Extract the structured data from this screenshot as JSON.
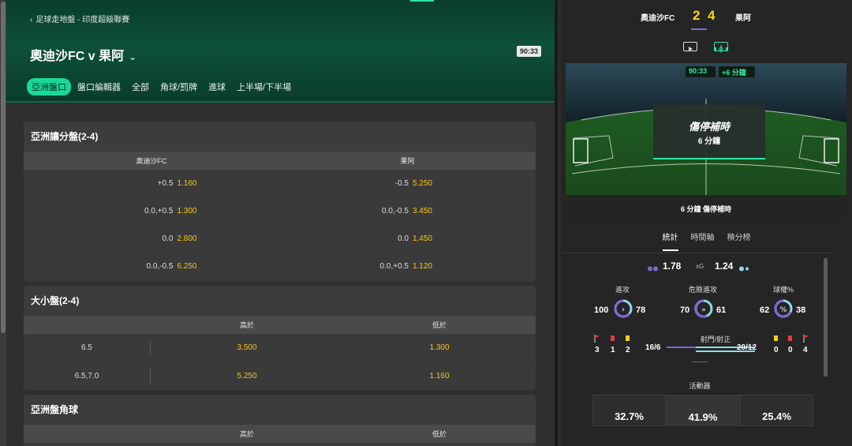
{
  "breadcrumb": "足球走地盤 - 印度超級聯賽",
  "match": {
    "title": "奧迪沙FC v 果阿",
    "clock": "90:33"
  },
  "tabs": [
    "亞洲盤口",
    "盤口編輯器",
    "全部",
    "角球/罰牌",
    "進球",
    "上半場/下半場"
  ],
  "markets": {
    "handicap": {
      "title": "亞洲讓分盤(2-4)",
      "home_header": "奧迪沙FC",
      "away_header": "果阿",
      "rows": [
        {
          "home_line": "+0.5",
          "home_odds": "1.160",
          "away_line": "-0.5",
          "away_odds": "5.250"
        },
        {
          "home_line": "0.0,+0.5",
          "home_odds": "1.300",
          "away_line": "0.0,-0.5",
          "away_odds": "3.450"
        },
        {
          "home_line": "0.0",
          "home_odds": "2.800",
          "away_line": "0.0",
          "away_odds": "1.450"
        },
        {
          "home_line": "0.0,-0.5",
          "home_odds": "6.250",
          "away_line": "0.0,+0.5",
          "away_odds": "1.120"
        }
      ]
    },
    "totals": {
      "title": "大小盤(2-4)",
      "over_header": "高於",
      "under_header": "低於",
      "rows": [
        {
          "line": "6.5",
          "over": "3.500",
          "under": "1.300"
        },
        {
          "line": "6.5,7.0",
          "over": "5.250",
          "under": "1.160"
        }
      ]
    },
    "corners": {
      "title": "亞洲盤角球",
      "over_header": "高於",
      "under_header": "低於"
    }
  },
  "scoreboard": {
    "home": "奧迪沙FC",
    "home_score": "2",
    "away_score": "4",
    "away": "果阿"
  },
  "scene": {
    "clock": "90:33",
    "added_badge": "+6 分鐘",
    "card_title": "傷停補時",
    "card_sub": "6 分鐘",
    "bottom_text": "6 分鐘  傷停補時"
  },
  "stats_tabs": [
    "統計",
    "時間軸",
    "積分榜"
  ],
  "xg": {
    "home": "1.78",
    "label": "xG",
    "away": "1.24"
  },
  "attacks": {
    "label": "進攻",
    "home": "100",
    "away": "78"
  },
  "danger": {
    "label": "危險進攻",
    "home": "70",
    "away": "61"
  },
  "possession": {
    "label": "球權%",
    "home": "62",
    "away": "38"
  },
  "cards": {
    "home_corners": "3",
    "home_red": "1",
    "home_yellow": "2",
    "away_yellow": "0",
    "away_red": "0",
    "away_corners": "4"
  },
  "shots": {
    "label": "射門/射正",
    "home": "16/6",
    "away": "20/12"
  },
  "activity": {
    "label": "活動器",
    "home": "32.7%",
    "mid": "41.9%",
    "away": "25.4%"
  },
  "colors": {
    "accent": "#19d898",
    "odds": "#f5c518",
    "home": "#7d6ad8",
    "away": "#8fd9e8"
  }
}
